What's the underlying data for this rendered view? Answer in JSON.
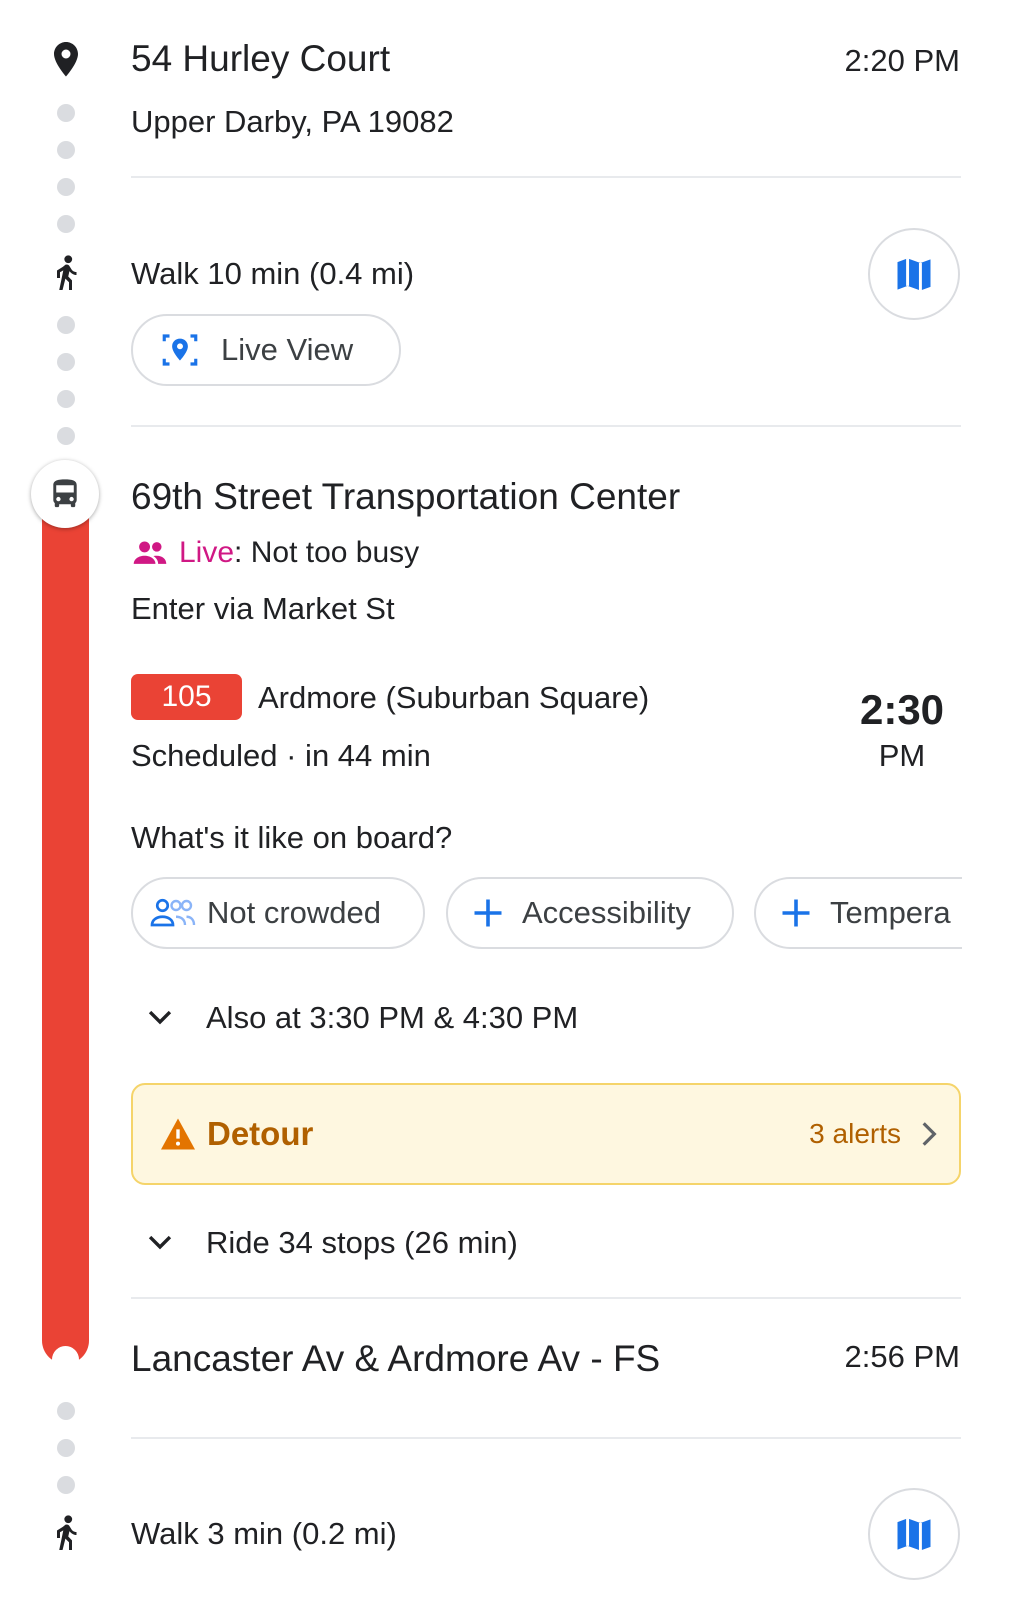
{
  "origin": {
    "name": "54 Hurley Court",
    "address": "Upper Darby, PA 19082",
    "time": "2:20 PM"
  },
  "walk1": {
    "text": "Walk 10 min (0.4 mi)",
    "live_view_label": "Live View"
  },
  "station": {
    "name": "69th Street Transportation Center",
    "live_label": "Live",
    "busyness": ": Not too busy",
    "entrance": "Enter via Market St"
  },
  "route": {
    "number": "105",
    "destination": "Ardmore (Suburban Square)",
    "status": "Scheduled · in 44 min",
    "departure_time": "2:30",
    "departure_ampm": "PM",
    "route_color": "#ea4335"
  },
  "onboard": {
    "question": "What's it like on board?",
    "chips": [
      {
        "label": "Not crowded",
        "icon": "people-icon"
      },
      {
        "label": "Accessibility",
        "icon": "plus-icon"
      },
      {
        "label": "Tempera",
        "icon": "plus-icon"
      }
    ]
  },
  "also_at": "Also at 3:30 PM & 4:30 PM",
  "alert": {
    "title": "Detour",
    "count": "3 alerts"
  },
  "ride": "Ride 34 stops (26 min)",
  "stop": {
    "name": "Lancaster Av & Ardmore Av - FS",
    "time": "2:56 PM"
  },
  "walk2": {
    "text": "Walk 3 min (0.2 mi)"
  }
}
